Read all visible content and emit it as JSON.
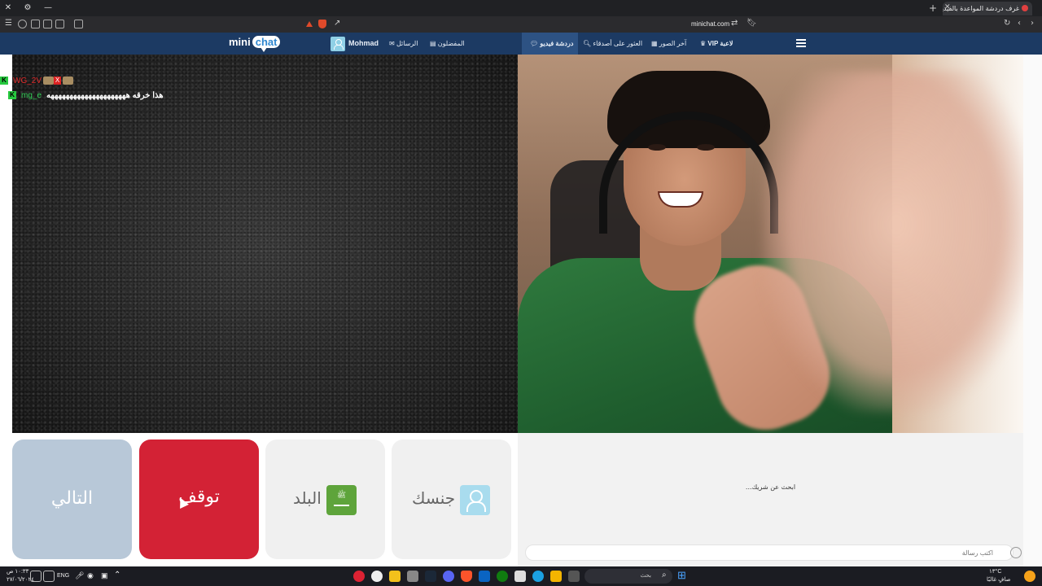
{
  "browser": {
    "tab_title": "غرف دردشة المواعدة بالفيديو -",
    "url": "minichat.com",
    "window_controls": [
      "close-icon",
      "minimize-icon",
      "settings-icon"
    ]
  },
  "site_nav": {
    "logo_part1": "mini",
    "logo_part2": "chat",
    "user_name": "Mohmad",
    "messages_label": "الرسائل",
    "favorites_label": "المفضلون",
    "video_chat_label": "دردشة فيديو",
    "find_friends_label": "العثور على أصدقاء",
    "last_photos_label": "آخر الصور",
    "vip_label": "VIP لاعبة"
  },
  "partner_chat": [
    {
      "badge": "K",
      "user": "WG_2V",
      "message": ""
    },
    {
      "badge": "K",
      "user": "mg_e",
      "message": "هذا خرقه هههههههههههههههههههههه"
    }
  ],
  "controls": {
    "next_label": "التالي",
    "stop_label": "توقف",
    "country_label": "البلد",
    "gender_label": "جنسك"
  },
  "chat_panel": {
    "status": "...ابحث عن شريك",
    "input_placeholder": "اكتب رسالة"
  },
  "taskbar": {
    "search_placeholder": "بحث",
    "language": "ENG",
    "time": "١٠:٣٣ ص",
    "date": "٢٧/٠٦/٢٠٢٤",
    "weather_temp": "١٣°C",
    "weather_desc": "صافٍ غالبًا"
  }
}
